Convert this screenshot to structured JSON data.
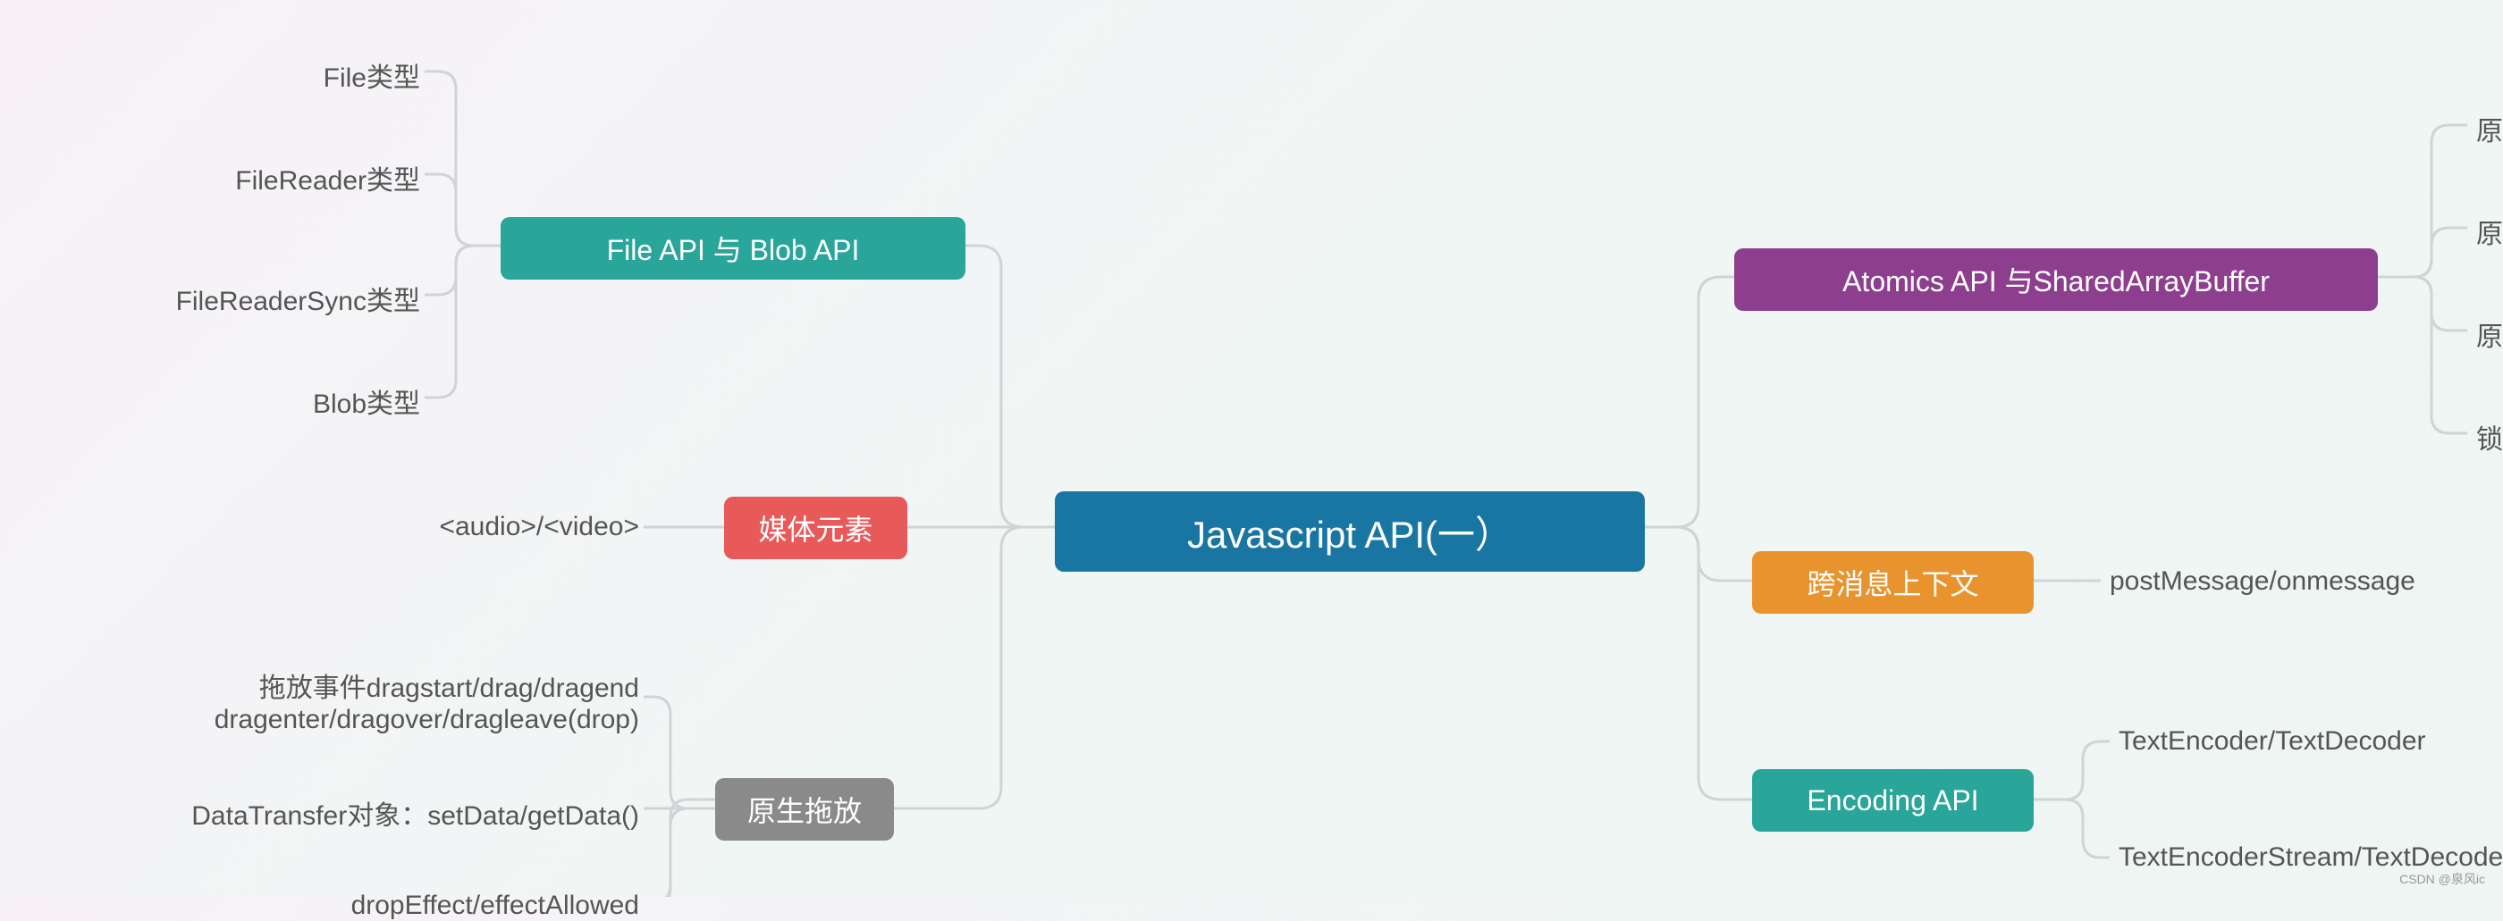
{
  "root": {
    "label": "Javascript API(一）"
  },
  "left": {
    "file_api": {
      "label": "File API 与 Blob API",
      "children": [
        "File类型",
        "FileReader类型",
        "FileReaderSync类型",
        "Blob类型"
      ]
    },
    "media": {
      "label": "媒体元素",
      "children": [
        "<audio>/<video>"
      ]
    },
    "dnd": {
      "label": "原生拖放",
      "children": [
        "拖放事件dragstart/drag/dragend\ndragenter/dragover/dragleave(drop)",
        "DataTransfer对象：setData/getData()",
        "dropEffect/effectAllowed"
      ]
    }
  },
  "right": {
    "atomics": {
      "label": "Atomics API 与SharedArrayBuffer",
      "children": [
        "原子操作",
        "原子交换",
        "原子读写",
        "锁"
      ]
    },
    "cross": {
      "label": "跨消息上下文",
      "children": [
        "postMessage/onmessage"
      ]
    },
    "encoding": {
      "label": "Encoding API",
      "children": [
        "TextEncoder/TextDecoder",
        "TextEncoderStream/TextDecoderStream"
      ]
    }
  },
  "watermark": "CSDN @泉风ic"
}
